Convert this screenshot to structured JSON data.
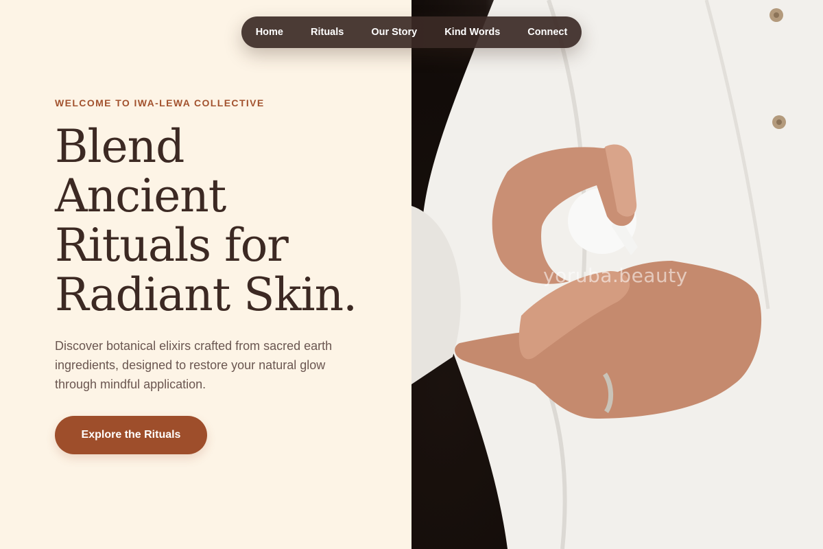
{
  "nav": {
    "items": [
      {
        "label": "Home"
      },
      {
        "label": "Rituals"
      },
      {
        "label": "Our Story"
      },
      {
        "label": "Kind Words"
      },
      {
        "label": "Connect"
      }
    ]
  },
  "hero": {
    "eyebrow": "WELCOME TO IWA-LEWA COLLECTIVE",
    "headline_lines": [
      "Blend",
      "Ancient",
      "Rituals for",
      "Radiant Skin."
    ],
    "description": "Discover botanical elixirs crafted from sacred earth ingredients, designed to restore your natural glow through mindful application.",
    "cta_label": "Explore the Rituals"
  },
  "image": {
    "watermark": "yoruba.beauty",
    "subject": "hands-applying-lotion-photo"
  },
  "colors": {
    "background": "#fdf4e6",
    "accent": "#9e4e2b",
    "eyebrow": "#a2522e",
    "heading": "#3c2923",
    "nav_bg": "#3c2a26"
  }
}
